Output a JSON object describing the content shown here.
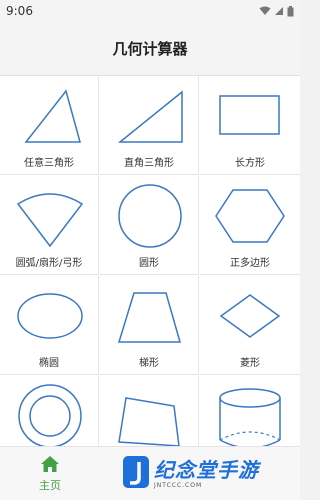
{
  "status_bar": {
    "time": "9:06",
    "icons": [
      "wifi-icon",
      "signal-icon",
      "battery-icon"
    ]
  },
  "header": {
    "title": "几何计算器"
  },
  "shapes": [
    {
      "label": "任意三角形",
      "icon": "arbitrary-triangle"
    },
    {
      "label": "直角三角形",
      "icon": "right-triangle"
    },
    {
      "label": "长方形",
      "icon": "rectangle"
    },
    {
      "label": "圆弧/扇形/弓形",
      "icon": "arc-sector-segment"
    },
    {
      "label": "圆形",
      "icon": "circle"
    },
    {
      "label": "正多边形",
      "icon": "regular-polygon"
    },
    {
      "label": "椭圆",
      "icon": "ellipse"
    },
    {
      "label": "梯形",
      "icon": "trapezoid"
    },
    {
      "label": "菱形",
      "icon": "rhombus"
    },
    {
      "label": "",
      "icon": "annulus"
    },
    {
      "label": "",
      "icon": "quadrilateral"
    },
    {
      "label": "",
      "icon": "cylinder"
    }
  ],
  "bottom_nav": {
    "home_label": "主页",
    "home_icon": "home-icon",
    "active_color": "#43a047"
  },
  "watermark": {
    "text": "纪念堂手游",
    "sub": "JNTCCC.COM"
  },
  "colors": {
    "shape_stroke": "#3a78c2",
    "accent": "#43a047"
  }
}
